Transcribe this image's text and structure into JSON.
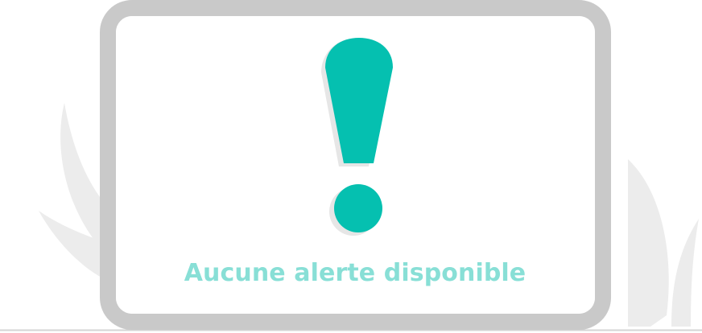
{
  "empty_state": {
    "message": "Aucune alerte disponible",
    "icon": "exclamation-icon",
    "colors": {
      "accent": "#05c0b0",
      "message_text": "#88dfd6",
      "frame": "#c9c9c9",
      "foliage": "#ececec",
      "floor_line": "#d4d4d4",
      "icon_shadow": "#e6e6e6"
    }
  }
}
